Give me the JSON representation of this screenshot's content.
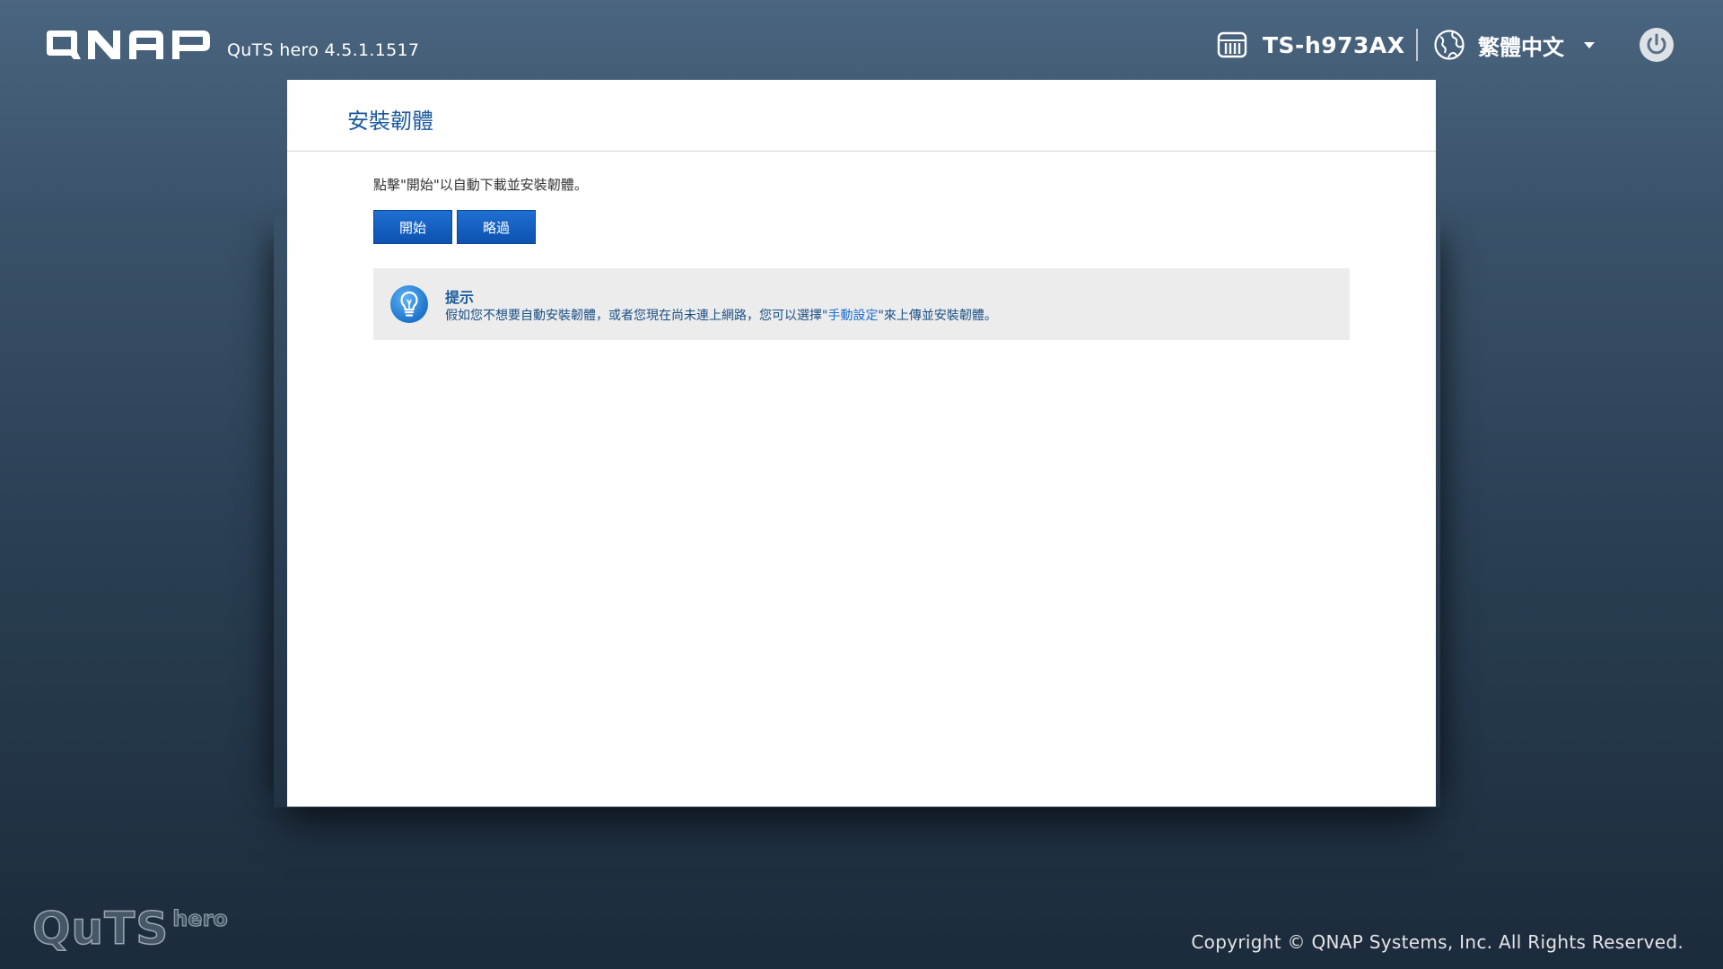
{
  "header": {
    "brand": "QNAP",
    "version": "QuTS hero 4.5.1.1517",
    "device_name": "TS-h973AX",
    "language": "繁體中文"
  },
  "panel": {
    "title": "安裝韌體",
    "instruction": "點擊\"開始\"以自動下載並安裝韌體。",
    "buttons": {
      "start": "開始",
      "skip": "略過"
    },
    "tip": {
      "title": "提示",
      "text_before": "假如您不想要自動安裝韌體，或者您現在尚未連上網路，您可以選擇\"",
      "link": "手動設定",
      "text_after": "\"來上傳並安裝韌體。"
    }
  },
  "footer": {
    "logo_main": "QuTS",
    "logo_sub": "hero",
    "copyright": "Copyright © QNAP Systems, Inc. All Rights Reserved."
  },
  "colors": {
    "accent": "#1a5a9c",
    "button": "#0d52b0",
    "link": "#1f6fd2",
    "tip_background": "#ececec"
  },
  "icons": {
    "device": "nas-device-icon",
    "language": "globe-icon",
    "power": "power-icon",
    "tip": "lightbulb-icon"
  }
}
